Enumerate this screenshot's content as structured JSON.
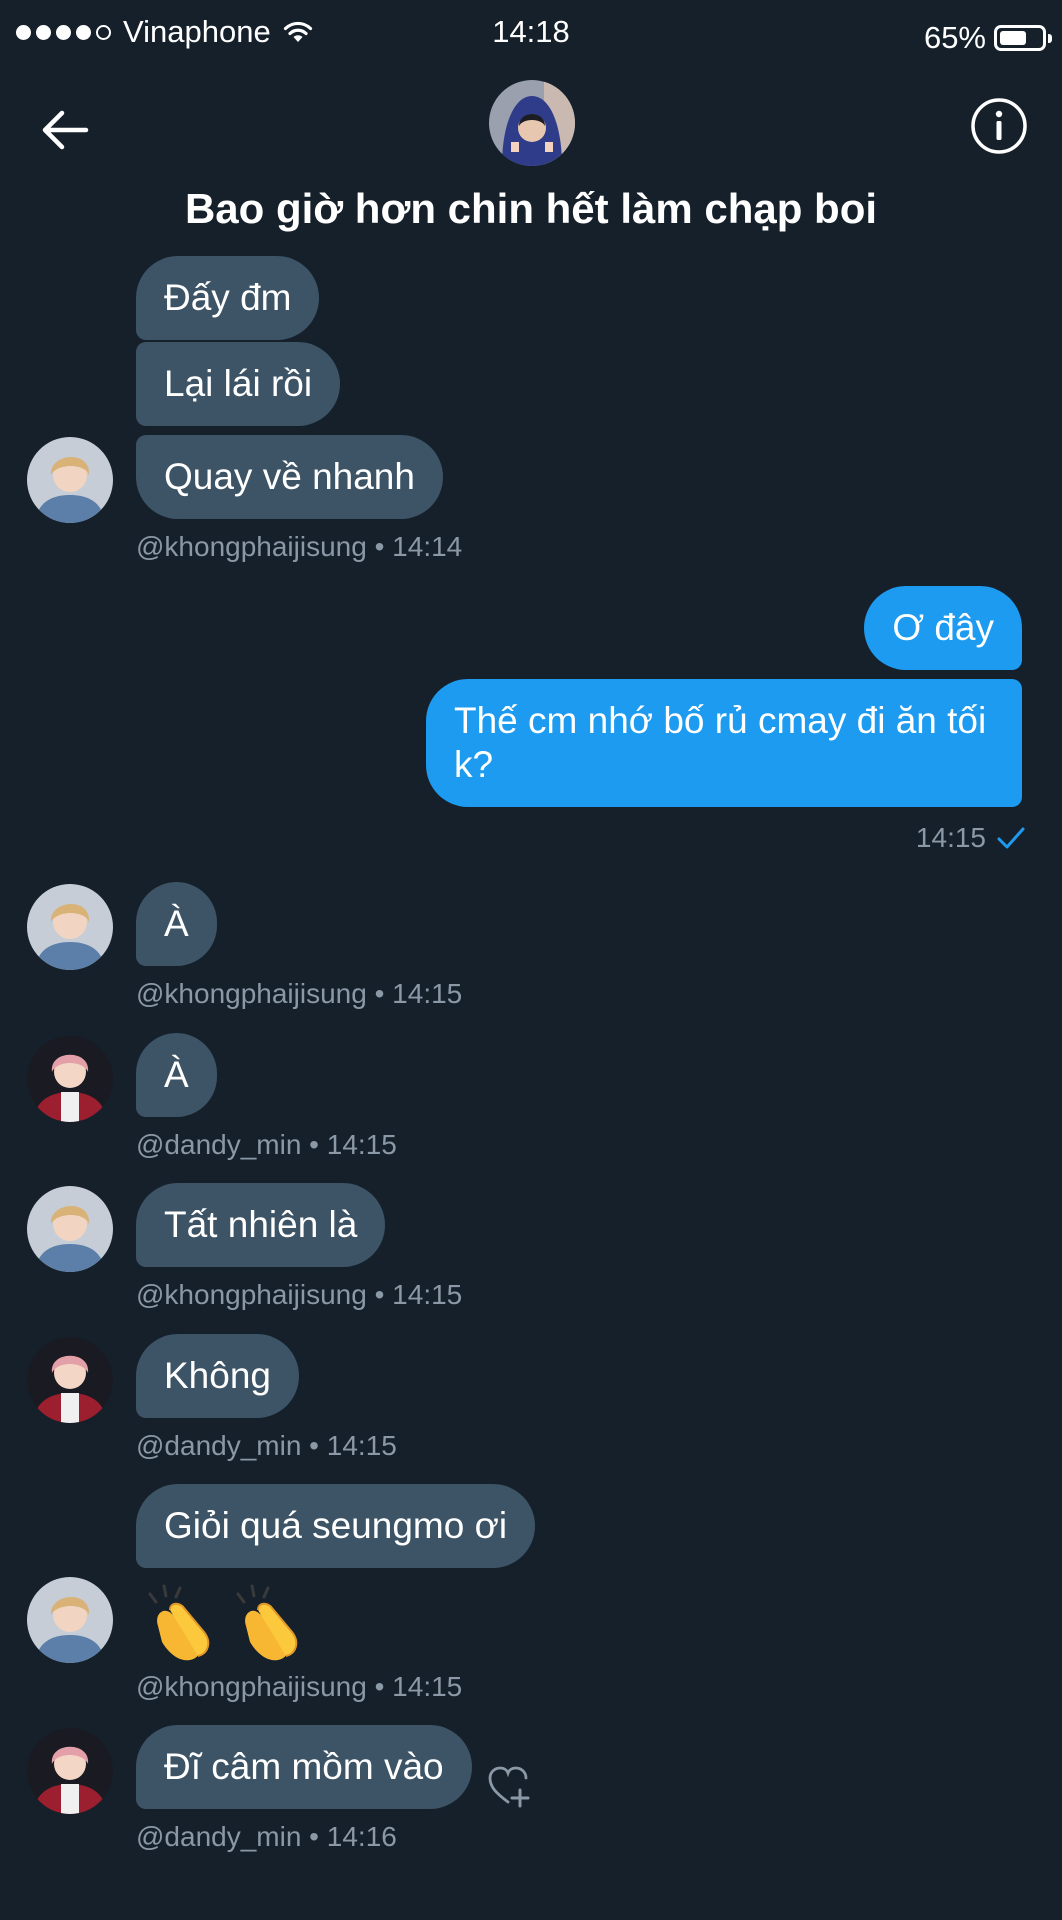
{
  "status": {
    "carrier": "Vinaphone",
    "time": "14:18",
    "battery": "65%",
    "battery_level": 0.65
  },
  "header": {
    "title": "Bao giờ hơn chin hết làm chạp boi"
  },
  "messages": {
    "m1": "Đấy đm",
    "m2": "Lại lái rồi",
    "m3": "Quay về nhanh",
    "meta1": "@khongphaijisung • 14:14",
    "s1": "Ơ đây",
    "s2": "Thế cm nhớ bố rủ cmay đi ăn tối k?",
    "meta_sent": "14:15",
    "m4": "À",
    "meta2": "@khongphaijisung • 14:15",
    "m5": "À",
    "meta3": "@dandy_min • 14:15",
    "m6": "Tất nhiên là",
    "meta4": "@khongphaijisung • 14:15",
    "m7": "Không",
    "meta5": "@dandy_min • 14:15",
    "m8": "Giỏi quá seungmo ơi",
    "m9_emoji": "👏👏",
    "meta6": "@khongphaijisung • 14:15",
    "m10": "Đĩ câm mồm vào",
    "meta7": "@dandy_min • 14:16"
  },
  "icons": {
    "back": "arrow-left-icon",
    "info": "info-icon",
    "read": "checkmark-icon",
    "react": "heart-plus-icon",
    "signal": "signal-dots-icon",
    "wifi": "wifi-icon",
    "battery": "battery-icon"
  },
  "colors": {
    "background": "#15202b",
    "received_bubble": "#3d5466",
    "sent_bubble": "#1d9bf0",
    "meta_text": "#8b98a5"
  }
}
